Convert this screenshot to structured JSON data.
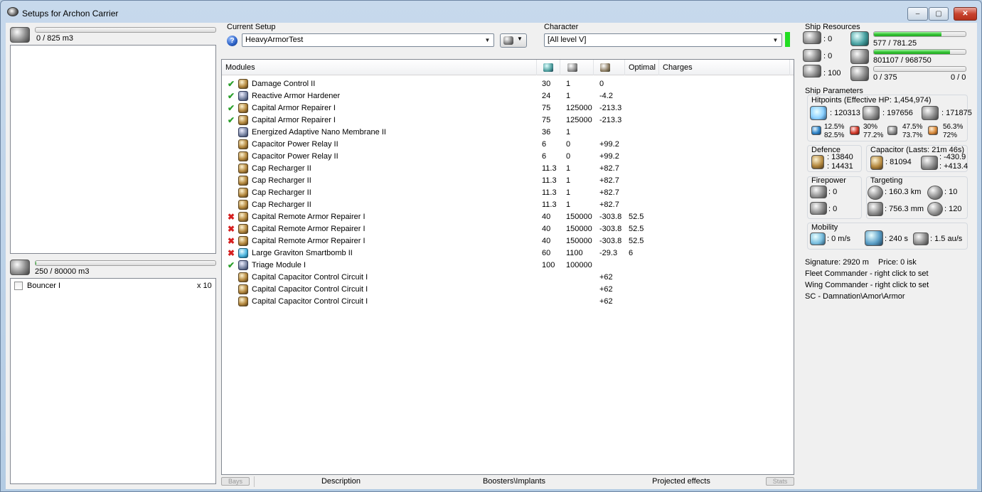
{
  "window": {
    "title": "Setups for Archon Carrier",
    "min_label": "–",
    "max_label": "▢",
    "close_label": "✕"
  },
  "cargo": {
    "capacity": "0 / 825 m3",
    "fraction": 0
  },
  "drones": {
    "capacity": "250 / 80000 m3",
    "fraction": 0.003,
    "items": [
      {
        "name": "Bouncer I",
        "qty": "x 10",
        "checked": false
      }
    ]
  },
  "current_setup": {
    "label": "Current Setup",
    "value": "HeavyArmorTest"
  },
  "character": {
    "label": "Character",
    "value": "[All level V]"
  },
  "modules": {
    "headers": {
      "name": "Modules",
      "optimal": "Optimal",
      "charges": "Charges"
    },
    "rows": [
      {
        "status": "ok",
        "name": "Damage Control II",
        "c1": "30",
        "c2": "1",
        "c3": "0",
        "optimal": ""
      },
      {
        "status": "ok",
        "name": "Reactive Armor Hardener",
        "c1": "24",
        "c2": "1",
        "c3": "-4.2",
        "optimal": ""
      },
      {
        "status": "ok",
        "name": "Capital Armor Repairer I",
        "c1": "75",
        "c2": "125000",
        "c3": "-213.3",
        "optimal": ""
      },
      {
        "status": "ok",
        "name": "Capital Armor Repairer I",
        "c1": "75",
        "c2": "125000",
        "c3": "-213.3",
        "optimal": ""
      },
      {
        "status": "",
        "name": "Energized Adaptive Nano Membrane II",
        "c1": "36",
        "c2": "1",
        "c3": "",
        "optimal": ""
      },
      {
        "status": "",
        "name": "Capacitor Power Relay II",
        "c1": "6",
        "c2": "0",
        "c3": "+99.2",
        "optimal": ""
      },
      {
        "status": "",
        "name": "Capacitor Power Relay II",
        "c1": "6",
        "c2": "0",
        "c3": "+99.2",
        "optimal": ""
      },
      {
        "status": "",
        "name": "Cap Recharger II",
        "c1": "11.3",
        "c2": "1",
        "c3": "+82.7",
        "optimal": ""
      },
      {
        "status": "",
        "name": "Cap Recharger II",
        "c1": "11.3",
        "c2": "1",
        "c3": "+82.7",
        "optimal": ""
      },
      {
        "status": "",
        "name": "Cap Recharger II",
        "c1": "11.3",
        "c2": "1",
        "c3": "+82.7",
        "optimal": ""
      },
      {
        "status": "",
        "name": "Cap Recharger II",
        "c1": "11.3",
        "c2": "1",
        "c3": "+82.7",
        "optimal": ""
      },
      {
        "status": "bad",
        "name": "Capital Remote Armor Repairer I",
        "c1": "40",
        "c2": "150000",
        "c3": "-303.8",
        "optimal": "52.5"
      },
      {
        "status": "bad",
        "name": "Capital Remote Armor Repairer I",
        "c1": "40",
        "c2": "150000",
        "c3": "-303.8",
        "optimal": "52.5"
      },
      {
        "status": "bad",
        "name": "Capital Remote Armor Repairer I",
        "c1": "40",
        "c2": "150000",
        "c3": "-303.8",
        "optimal": "52.5"
      },
      {
        "status": "bad",
        "name": "Large Graviton Smartbomb II",
        "c1": "60",
        "c2": "1100",
        "c3": "-29.3",
        "optimal": "6"
      },
      {
        "status": "ok",
        "name": "Triage Module I",
        "c1": "100",
        "c2": "100000",
        "c3": "",
        "optimal": ""
      },
      {
        "status": "",
        "name": "Capital Capacitor Control Circuit I",
        "c1": "",
        "c2": "",
        "c3": "+62",
        "optimal": ""
      },
      {
        "status": "",
        "name": "Capital Capacitor Control Circuit I",
        "c1": "",
        "c2": "",
        "c3": "+62",
        "optimal": ""
      },
      {
        "status": "",
        "name": "Capital Capacitor Control Circuit I",
        "c1": "",
        "c2": "",
        "c3": "+62",
        "optimal": ""
      }
    ]
  },
  "bottom_tabs": {
    "bays": "Bays",
    "description": "Description",
    "boosters": "Boosters\\Implants",
    "projected": "Projected effects",
    "stats": "Stats"
  },
  "resources": {
    "title": "Ship Resources",
    "turrets": ": 0",
    "launchers": ": 0",
    "calibration": ": 100",
    "cpu": {
      "text": "577 / 781.25",
      "fraction": 0.7386
    },
    "powergrid": {
      "text": "801107 / 968750",
      "fraction": 0.8269
    },
    "drone_bw": {
      "text": "0 / 375",
      "fraction": 0
    },
    "drone_count": "0 / 0"
  },
  "parameters": {
    "title": "Ship Parameters",
    "hitpoints": {
      "title": "Hitpoints (Effective HP: 1,454,974)",
      "shield": ": 120313",
      "armor": ": 197656",
      "structure": ": 171875",
      "em": {
        "shield": "12.5%",
        "armor": "82.5%"
      },
      "thermal": {
        "shield": "30%",
        "armor": "77.2%"
      },
      "kinetic": {
        "shield": "47.5%",
        "armor": "73.7%"
      },
      "explosive": {
        "shield": "56.3%",
        "armor": "72%"
      }
    },
    "defence": {
      "title": "Defence",
      "v1": ": 13840",
      "v2": ": 14431"
    },
    "capacitor": {
      "title": "Capacitor (Lasts: 21m 46s)",
      "amount": ": 81094",
      "v1": ": -430.9",
      "v2": ": +413.4"
    },
    "firepower": {
      "title": "Firepower",
      "v1": ": 0",
      "v2": ": 0"
    },
    "targeting": {
      "title": "Targeting",
      "range": ": 160.3 km",
      "targets": ": 10",
      "res": ": 756.3 mm",
      "sensor": ": 120"
    },
    "mobility": {
      "title": "Mobility",
      "speed": ": 0 m/s",
      "align": ": 240 s",
      "warp": ": 1.5 au/s"
    }
  },
  "info": {
    "signature": "Signature: 2920 m",
    "price": "Price: 0 isk",
    "fleet": "Fleet Commander - right click to set",
    "wing": "Wing Commander - right click to set",
    "squad": "SC - Damnation\\Amor\\Armor"
  }
}
